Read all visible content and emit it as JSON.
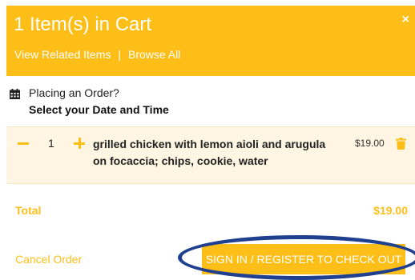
{
  "header": {
    "title": "1 Item(s) in Cart",
    "close_icon": "×",
    "links": [
      {
        "label": "View Related Items"
      },
      {
        "label": "Browse All"
      }
    ],
    "separator": "|"
  },
  "order_time": {
    "line1": "Placing an Order?",
    "line2": "Select your Date and Time",
    "icon": "calendar-icon"
  },
  "cart": {
    "items": [
      {
        "quantity": "1",
        "name": "grilled chicken with lemon aioli and arugula on focaccia; chips, cookie, water",
        "price": "$19.00",
        "remove_icon": "trash-icon"
      }
    ]
  },
  "total": {
    "label": "Total",
    "value": "$19.00"
  },
  "footer": {
    "cancel_label": "Cancel Order",
    "checkout_label": "SIGN IN / REGISTER TO CHECK OUT"
  },
  "colors": {
    "accent": "#fdbe18",
    "item_background": "#fef6e2",
    "highlight_ring": "#1f3f8f"
  }
}
